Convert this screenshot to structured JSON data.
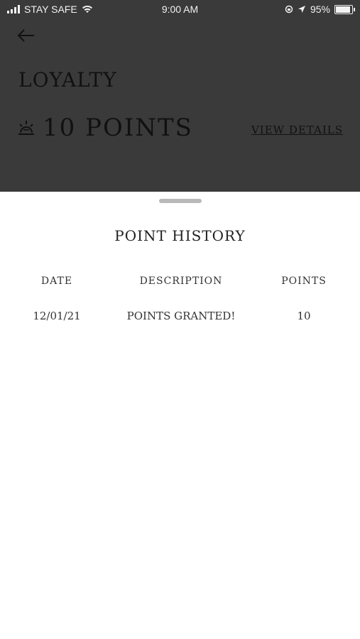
{
  "status_bar": {
    "carrier": "STAY SAFE",
    "time": "9:00 AM",
    "battery": "95%"
  },
  "header": {
    "title": "LOYALTY",
    "points_value": "10 POINTS",
    "view_details_label": "VIEW DETAILS"
  },
  "sheet": {
    "title": "POINT HISTORY",
    "columns": [
      "DATE",
      "DESCRIPTION",
      "POINTS"
    ],
    "rows": [
      {
        "date": "12/01/21",
        "description": "POINTS GRANTED!",
        "points": "10"
      }
    ]
  }
}
